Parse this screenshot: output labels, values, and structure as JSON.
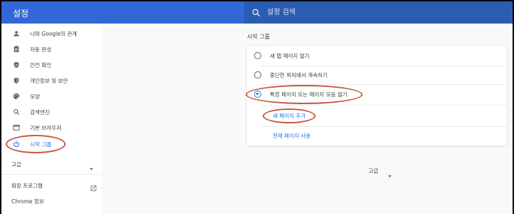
{
  "header": {
    "title": "설정",
    "search_placeholder": "설정 검색",
    "search_icon": "search-icon"
  },
  "sidebar": {
    "items": [
      {
        "label": "나와 Google의 관계",
        "icon": "person-icon"
      },
      {
        "label": "자동 완성",
        "icon": "clipboard-icon"
      },
      {
        "label": "안전 확인",
        "icon": "shield-icon"
      },
      {
        "label": "개인정보 및 보안",
        "icon": "shield-lock-icon"
      },
      {
        "label": "모양",
        "icon": "palette-icon"
      },
      {
        "label": "검색엔진",
        "icon": "search-icon"
      },
      {
        "label": "기본 브라우저",
        "icon": "browser-icon"
      },
      {
        "label": "시작 그룹",
        "icon": "power-icon",
        "active": true
      }
    ],
    "advanced_label": "고급",
    "extensions_label": "확장 프로그램",
    "about_label": "Chrome 정보"
  },
  "main": {
    "section_title": "시작 그룹",
    "options": [
      {
        "label": "새 탭 페이지 열기",
        "checked": false
      },
      {
        "label": "중단한 위치에서 계속하기",
        "checked": false
      },
      {
        "label": "특정 페이지 또는 페이지 모음 열기",
        "checked": true
      }
    ],
    "add_page_link": "새 페이지 추가",
    "use_current_link": "현재 페이지 사용",
    "advanced_label": "고급"
  },
  "colors": {
    "header_blue": "#3367d6",
    "accent_blue": "#1a73e8",
    "annotation": "#c8593e"
  }
}
